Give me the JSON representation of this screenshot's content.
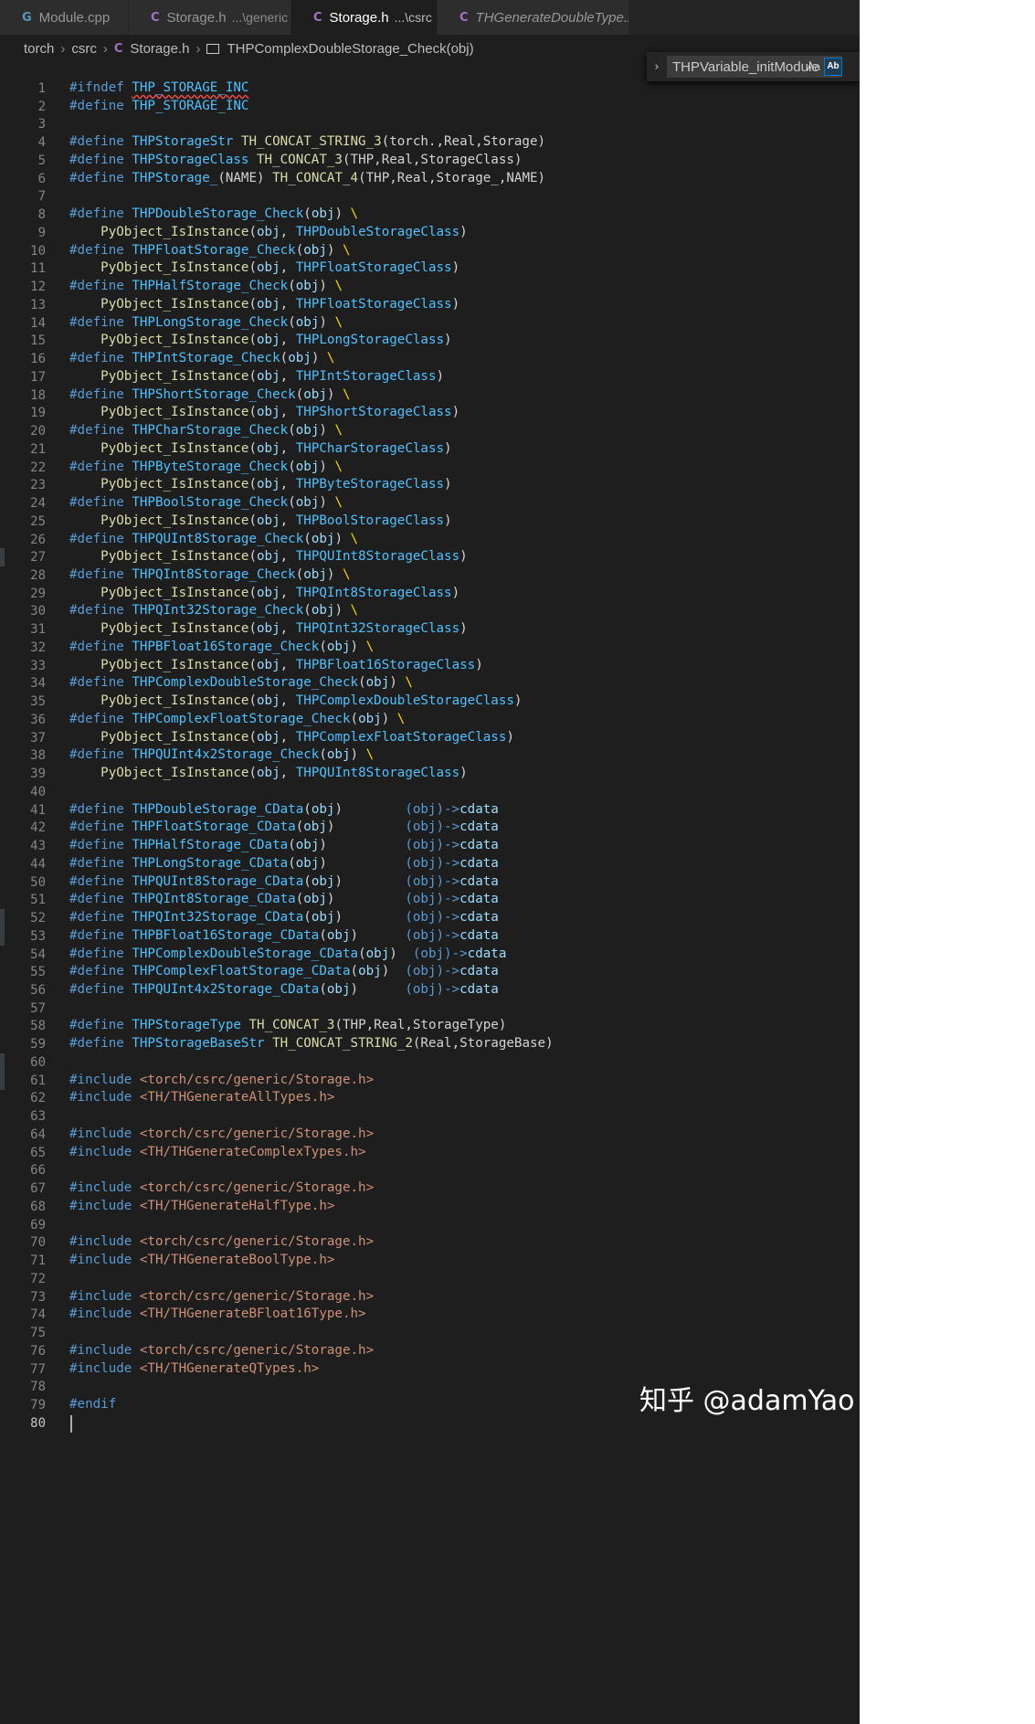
{
  "tabs": [
    {
      "icon": "cpp-file-icon",
      "icon_glyph": "G",
      "icon_color": "#519aba",
      "label": "Module.cpp",
      "desc": "",
      "active": false,
      "italic": false,
      "pinned": false
    },
    {
      "icon": "c-header-icon",
      "icon_glyph": "C",
      "icon_color": "#a074c4",
      "label": "Storage.h",
      "desc": "...\\generic",
      "active": false,
      "italic": false,
      "pinned": false
    },
    {
      "icon": "c-header-icon",
      "icon_glyph": "C",
      "icon_color": "#a074c4",
      "label": "Storage.h",
      "desc": "...\\csrc",
      "active": true,
      "italic": false,
      "pinned": true
    },
    {
      "icon": "c-header-icon",
      "icon_glyph": "C",
      "icon_color": "#a074c4",
      "label": "THGenerateDoubleType.h",
      "desc": "",
      "active": false,
      "italic": true,
      "pinned": false
    }
  ],
  "breadcrumb": {
    "items": [
      "torch",
      "csrc",
      "Storage.h",
      "THPComplexDoubleStorage_Check(obj)"
    ]
  },
  "find_widget": {
    "toggle_icon": "chevron-right-icon",
    "value": "THPVariable_initModule",
    "match_case_label": "Aa",
    "whole_word_label": "Ab"
  },
  "editor": {
    "lines": [
      {
        "n": "1",
        "t": "#ifndef THP_STORAGE_INC"
      },
      {
        "n": "2",
        "t": "#define THP_STORAGE_INC"
      },
      {
        "n": "3",
        "t": ""
      },
      {
        "n": "4",
        "t": "#define THPStorageStr TH_CONCAT_STRING_3(torch.,Real,Storage)"
      },
      {
        "n": "5",
        "t": "#define THPStorageClass TH_CONCAT_3(THP,Real,StorageClass)"
      },
      {
        "n": "6",
        "t": "#define THPStorage_(NAME) TH_CONCAT_4(THP,Real,Storage_,NAME)"
      },
      {
        "n": "7",
        "t": ""
      },
      {
        "n": "8",
        "t": "#define THPDoubleStorage_Check(obj) \\"
      },
      {
        "n": "9",
        "t": "    PyObject_IsInstance(obj, THPDoubleStorageClass)"
      },
      {
        "n": "10",
        "t": "#define THPFloatStorage_Check(obj) \\"
      },
      {
        "n": "11",
        "t": "    PyObject_IsInstance(obj, THPFloatStorageClass)"
      },
      {
        "n": "12",
        "t": "#define THPHalfStorage_Check(obj) \\"
      },
      {
        "n": "13",
        "t": "    PyObject_IsInstance(obj, THPFloatStorageClass)"
      },
      {
        "n": "14",
        "t": "#define THPLongStorage_Check(obj) \\"
      },
      {
        "n": "15",
        "t": "    PyObject_IsInstance(obj, THPLongStorageClass)"
      },
      {
        "n": "16",
        "t": "#define THPIntStorage_Check(obj) \\"
      },
      {
        "n": "17",
        "t": "    PyObject_IsInstance(obj, THPIntStorageClass)"
      },
      {
        "n": "18",
        "t": "#define THPShortStorage_Check(obj) \\"
      },
      {
        "n": "19",
        "t": "    PyObject_IsInstance(obj, THPShortStorageClass)"
      },
      {
        "n": "20",
        "t": "#define THPCharStorage_Check(obj) \\"
      },
      {
        "n": "21",
        "t": "    PyObject_IsInstance(obj, THPCharStorageClass)"
      },
      {
        "n": "22",
        "t": "#define THPByteStorage_Check(obj) \\"
      },
      {
        "n": "23",
        "t": "    PyObject_IsInstance(obj, THPByteStorageClass)"
      },
      {
        "n": "24",
        "t": "#define THPBoolStorage_Check(obj) \\"
      },
      {
        "n": "25",
        "t": "    PyObject_IsInstance(obj, THPBoolStorageClass)"
      },
      {
        "n": "26",
        "t": "#define THPQUInt8Storage_Check(obj) \\"
      },
      {
        "n": "27",
        "t": "    PyObject_IsInstance(obj, THPQUInt8StorageClass)"
      },
      {
        "n": "28",
        "t": "#define THPQInt8Storage_Check(obj) \\"
      },
      {
        "n": "29",
        "t": "    PyObject_IsInstance(obj, THPQInt8StorageClass)"
      },
      {
        "n": "30",
        "t": "#define THPQInt32Storage_Check(obj) \\"
      },
      {
        "n": "31",
        "t": "    PyObject_IsInstance(obj, THPQInt32StorageClass)"
      },
      {
        "n": "32",
        "t": "#define THPBFloat16Storage_Check(obj) \\"
      },
      {
        "n": "33",
        "t": "    PyObject_IsInstance(obj, THPBFloat16StorageClass)"
      },
      {
        "n": "34",
        "t": "#define THPComplexDoubleStorage_Check(obj) \\"
      },
      {
        "n": "35",
        "t": "    PyObject_IsInstance(obj, THPComplexDoubleStorageClass)"
      },
      {
        "n": "36",
        "t": "#define THPComplexFloatStorage_Check(obj) \\"
      },
      {
        "n": "37",
        "t": "    PyObject_IsInstance(obj, THPComplexFloatStorageClass)"
      },
      {
        "n": "38",
        "t": "#define THPQUInt4x2Storage_Check(obj) \\"
      },
      {
        "n": "39",
        "t": "    PyObject_IsInstance(obj, THPQUInt8StorageClass)"
      },
      {
        "n": "40",
        "t": ""
      },
      {
        "n": "41",
        "t": "#define THPDoubleStorage_CData(obj)        (obj)->cdata"
      },
      {
        "n": "42",
        "t": "#define THPFloatStorage_CData(obj)         (obj)->cdata"
      },
      {
        "n": "43",
        "t": "#define THPHalfStorage_CData(obj)          (obj)->cdata"
      },
      {
        "n": "44",
        "t": "#define THPLongStorage_CData(obj)          (obj)->cdata"
      },
      {
        "n": "50",
        "t": "#define THPQUInt8Storage_CData(obj)        (obj)->cdata"
      },
      {
        "n": "51",
        "t": "#define THPQInt8Storage_CData(obj)         (obj)->cdata"
      },
      {
        "n": "52",
        "t": "#define THPQInt32Storage_CData(obj)        (obj)->cdata"
      },
      {
        "n": "53",
        "t": "#define THPBFloat16Storage_CData(obj)      (obj)->cdata"
      },
      {
        "n": "54",
        "t": "#define THPComplexDoubleStorage_CData(obj)  (obj)->cdata"
      },
      {
        "n": "55",
        "t": "#define THPComplexFloatStorage_CData(obj)  (obj)->cdata"
      },
      {
        "n": "56",
        "t": "#define THPQUInt4x2Storage_CData(obj)      (obj)->cdata"
      },
      {
        "n": "57",
        "t": ""
      },
      {
        "n": "58",
        "t": "#define THPStorageType TH_CONCAT_3(THP,Real,StorageType)"
      },
      {
        "n": "59",
        "t": "#define THPStorageBaseStr TH_CONCAT_STRING_2(Real,StorageBase)"
      },
      {
        "n": "60",
        "t": ""
      },
      {
        "n": "61",
        "t": "#include <torch/csrc/generic/Storage.h>"
      },
      {
        "n": "62",
        "t": "#include <TH/THGenerateAllTypes.h>"
      },
      {
        "n": "63",
        "t": ""
      },
      {
        "n": "64",
        "t": "#include <torch/csrc/generic/Storage.h>"
      },
      {
        "n": "65",
        "t": "#include <TH/THGenerateComplexTypes.h>"
      },
      {
        "n": "66",
        "t": ""
      },
      {
        "n": "67",
        "t": "#include <torch/csrc/generic/Storage.h>"
      },
      {
        "n": "68",
        "t": "#include <TH/THGenerateHalfType.h>"
      },
      {
        "n": "69",
        "t": ""
      },
      {
        "n": "70",
        "t": "#include <torch/csrc/generic/Storage.h>"
      },
      {
        "n": "71",
        "t": "#include <TH/THGenerateBoolType.h>"
      },
      {
        "n": "72",
        "t": ""
      },
      {
        "n": "73",
        "t": "#include <torch/csrc/generic/Storage.h>"
      },
      {
        "n": "74",
        "t": "#include <TH/THGenerateBFloat16Type.h>"
      },
      {
        "n": "75",
        "t": ""
      },
      {
        "n": "76",
        "t": "#include <torch/csrc/generic/Storage.h>"
      },
      {
        "n": "77",
        "t": "#include <TH/THGenerateQTypes.h>"
      },
      {
        "n": "78",
        "t": ""
      },
      {
        "n": "79",
        "t": "#endif"
      },
      {
        "n": "80",
        "t": ""
      }
    ]
  },
  "watermark": {
    "text": "知乎 @adamYao"
  },
  "colors": {
    "editor_bg": "#1e1e1e",
    "keyword": "#569cd6",
    "macro": "#4fc1ff",
    "function": "#dcdcaa",
    "parameter": "#9cdcfe",
    "string": "#ce9178",
    "bracket": "#ffd700",
    "line_number": "#858585"
  }
}
